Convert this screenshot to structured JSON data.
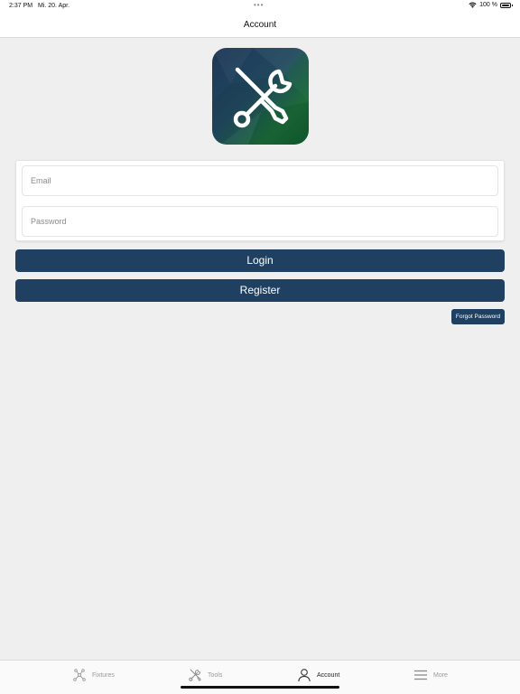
{
  "status_bar": {
    "time": "2:37 PM",
    "date": "Mi. 20. Apr.",
    "dots": "•••",
    "battery": "100 %",
    "icons": [
      "wifi-icon",
      "battery-icon"
    ]
  },
  "nav": {
    "title": "Account"
  },
  "logo": {
    "icon": "wrench-screwdriver-icon",
    "gradient": [
      "#1e3656",
      "#20485e",
      "#1d6a3a",
      "#0f5a2e"
    ]
  },
  "form": {
    "email_placeholder": "Email",
    "email_value": "",
    "password_placeholder": "Password",
    "password_value": ""
  },
  "buttons": {
    "login": "Login",
    "register": "Register",
    "forgot_password": "Forgot Password"
  },
  "tabs": [
    {
      "label": "Fixtures",
      "icon": "fixtures-icon",
      "active": false
    },
    {
      "label": "Tools",
      "icon": "tools-icon",
      "active": false
    },
    {
      "label": "Account",
      "icon": "person-icon",
      "active": true
    },
    {
      "label": "More",
      "icon": "menu-icon",
      "active": false
    }
  ],
  "colors": {
    "primary": "#1f4060",
    "background": "#efefef",
    "tab_inactive": "#9a9a9a",
    "tab_active": "#222222"
  }
}
